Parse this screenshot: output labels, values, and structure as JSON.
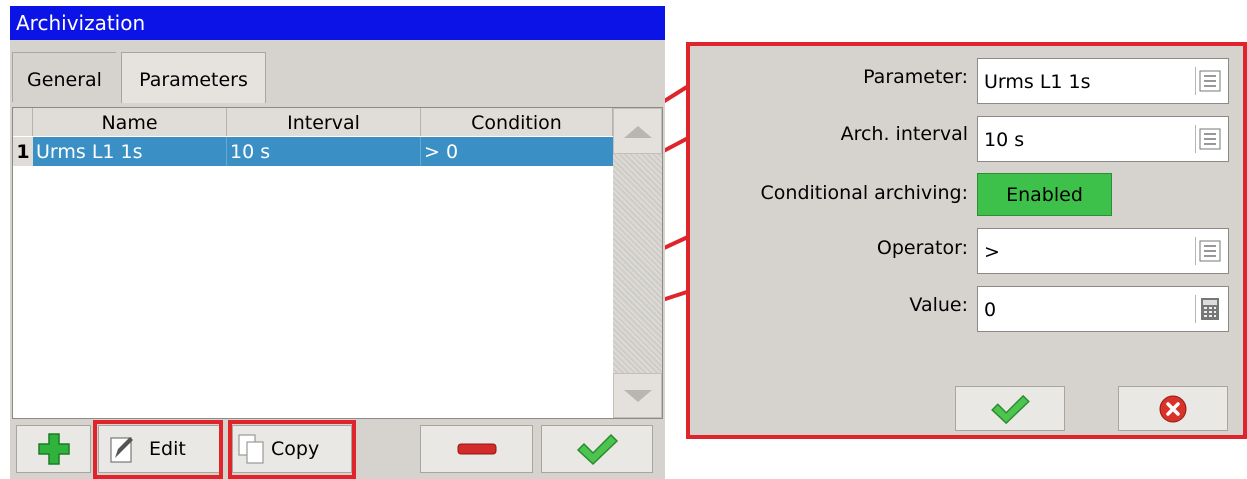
{
  "window": {
    "title": "Archivization"
  },
  "tabs": [
    {
      "label": "General"
    },
    {
      "label": "Parameters"
    }
  ],
  "table": {
    "columns": [
      "Name",
      "Interval",
      "Condition"
    ],
    "rows": [
      {
        "num": "1",
        "name": "Urms L1 1s",
        "interval": "10 s",
        "condition": "> 0"
      }
    ]
  },
  "toolbar": {
    "edit_label": "Edit",
    "copy_label": "Copy"
  },
  "panel": {
    "parameter": {
      "label": "Parameter:",
      "value": "Urms L1 1s"
    },
    "arch_interval": {
      "label": "Arch. interval",
      "value": "10 s"
    },
    "conditional": {
      "label": "Conditional archiving:",
      "button": "Enabled"
    },
    "operator": {
      "label": "Operator:",
      "value": ">"
    },
    "value": {
      "label": "Value:",
      "value": "0"
    }
  },
  "colors": {
    "accent_red": "#e0242b",
    "title_blue": "#0b13e6",
    "selection_blue": "#3a8fc4",
    "enabled_green": "#3ec14a"
  }
}
